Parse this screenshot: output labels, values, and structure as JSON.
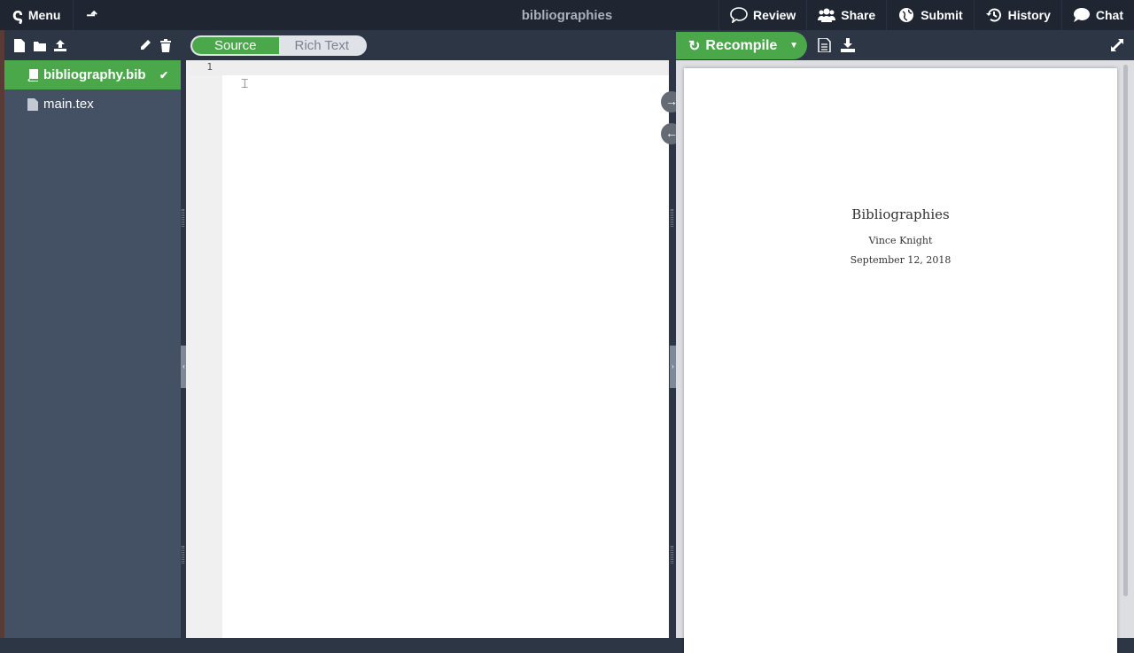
{
  "topbar": {
    "menu_label": "Menu",
    "project_title": "bibliographies",
    "buttons": [
      {
        "label": "Review",
        "icon": "review-icon"
      },
      {
        "label": "Share",
        "icon": "users-icon"
      },
      {
        "label": "Submit",
        "icon": "globe-icon"
      },
      {
        "label": "History",
        "icon": "history-icon"
      },
      {
        "label": "Chat",
        "icon": "chat-icon"
      }
    ]
  },
  "sidebar": {
    "tools": [
      "new-file-icon",
      "new-folder-icon",
      "upload-icon",
      "rename-icon",
      "delete-icon"
    ],
    "files": [
      {
        "name": "bibliography.bib",
        "active": true,
        "icon": "book-icon"
      },
      {
        "name": "main.tex",
        "active": false,
        "icon": "file-icon"
      }
    ]
  },
  "editor": {
    "mode_toggle": {
      "source": "Source",
      "rich_text": "Rich Text",
      "selected": "Source"
    },
    "line_numbers": [
      "1"
    ],
    "content": ""
  },
  "pdf": {
    "recompile_label": "Recompile",
    "document": {
      "title": "Bibliographies",
      "author": "Vince Knight",
      "date": "September 12, 2018"
    }
  }
}
